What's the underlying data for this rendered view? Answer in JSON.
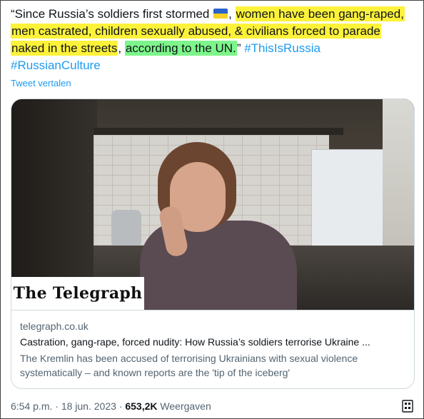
{
  "tweet": {
    "text_part1": "“Since Russia’s soldiers first stormed ",
    "flag_icon": "ukraine-flag-emoji",
    "text_comma": ",",
    "highlight_yellow_1": "women have been gang-raped,",
    "highlight_yellow_2": "men castrated, children sexually abused, & civilians forced to parade",
    "highlight_yellow_3": "naked in the streets",
    "text_comma2": ",",
    "highlight_green": "according to the UN.",
    "text_quote_end": "” ",
    "hashtag_1": "#ThisIsRussia",
    "hashtag_2": "#RussianCulture",
    "translate_link": "Tweet vertalen"
  },
  "card": {
    "logo_text": "The Telegraph",
    "domain": "telegraph.co.uk",
    "title": "Castration, gang-rape, forced nudity: How Russia’s soldiers terrorise Ukraine ...",
    "description": "The Kremlin has been accused of terrorising Ukrainians with sexual violence systematically – and known reports are the 'tip of the iceberg'"
  },
  "meta": {
    "time": "6:54 p.m.",
    "separator": "·",
    "date": "18 jun. 2023",
    "views_count": "653,2K",
    "views_label": "Weergaven"
  },
  "colors": {
    "highlight_yellow": "#fdf23a",
    "highlight_green": "#7df58a",
    "link_blue": "#1d9bf0",
    "secondary_text": "#536471"
  }
}
